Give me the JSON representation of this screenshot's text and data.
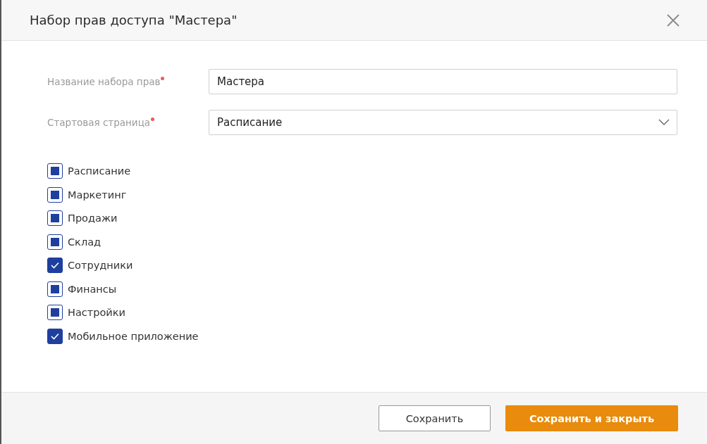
{
  "window": {
    "title": "Набор прав доступа \"Мастера\""
  },
  "fields": [
    {
      "kind": "text",
      "label": "Название набора прав",
      "required": true,
      "value": "Мастера"
    },
    {
      "kind": "select",
      "label": "Стартовая страница",
      "required": true,
      "value": "Расписание"
    }
  ],
  "permissions": [
    {
      "label": "Расписание",
      "checked": false,
      "indeterminate": true
    },
    {
      "label": "Маркетинг",
      "checked": false,
      "indeterminate": true
    },
    {
      "label": "Продажи",
      "checked": false,
      "indeterminate": true
    },
    {
      "label": "Склад",
      "checked": false,
      "indeterminate": true
    },
    {
      "label": "Сотрудники",
      "checked": true
    },
    {
      "label": "Финансы",
      "checked": false,
      "indeterminate": true
    },
    {
      "label": "Настройки",
      "checked": false,
      "indeterminate": true
    },
    {
      "label": "Мобильное приложение",
      "checked": true
    }
  ],
  "buttons": [
    {
      "kind": "secondary",
      "label": "Сохранить"
    },
    {
      "kind": "primary",
      "label": "Сохранить и закрыть"
    }
  ]
}
